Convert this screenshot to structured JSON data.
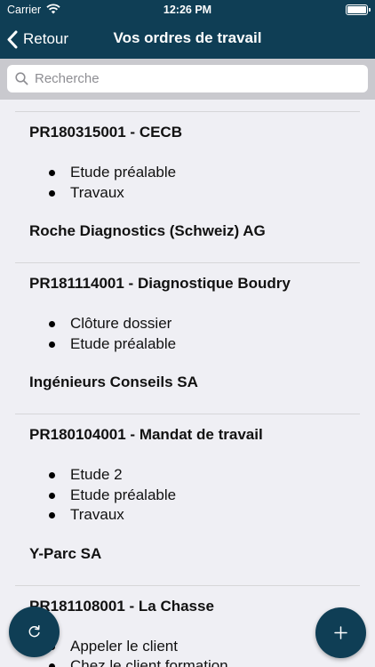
{
  "status": {
    "carrier": "Carrier",
    "time": "12:26 PM"
  },
  "nav": {
    "back_label": "Retour",
    "title": "Vos ordres de travail"
  },
  "search": {
    "placeholder": "Recherche"
  },
  "orders": [
    {
      "title": "PR180315001 - CECB",
      "tasks": [
        "Etude préalable",
        "Travaux"
      ],
      "client": "Roche Diagnostics (Schweiz) AG"
    },
    {
      "title": "PR181114001 - Diagnostique Boudry",
      "tasks": [
        "Clôture dossier",
        "Etude préalable"
      ],
      "client": "Ingénieurs Conseils SA"
    },
    {
      "title": "PR180104001 - Mandat de travail",
      "tasks": [
        "Etude 2",
        "Etude préalable",
        "Travaux"
      ],
      "client": "Y-Parc SA"
    },
    {
      "title": "PR181108001 - La Chasse",
      "tasks": [
        "Appeler le client",
        "Chez le client formation"
      ],
      "client": ""
    }
  ],
  "colors": {
    "nav_bg": "#0f3e55",
    "list_bg": "#efeff4",
    "search_bg": "#c9c9ce"
  },
  "icons": {
    "back": "chevron-left-icon",
    "search": "magnifier-icon",
    "refresh": "refresh-icon",
    "add": "plus-icon"
  }
}
